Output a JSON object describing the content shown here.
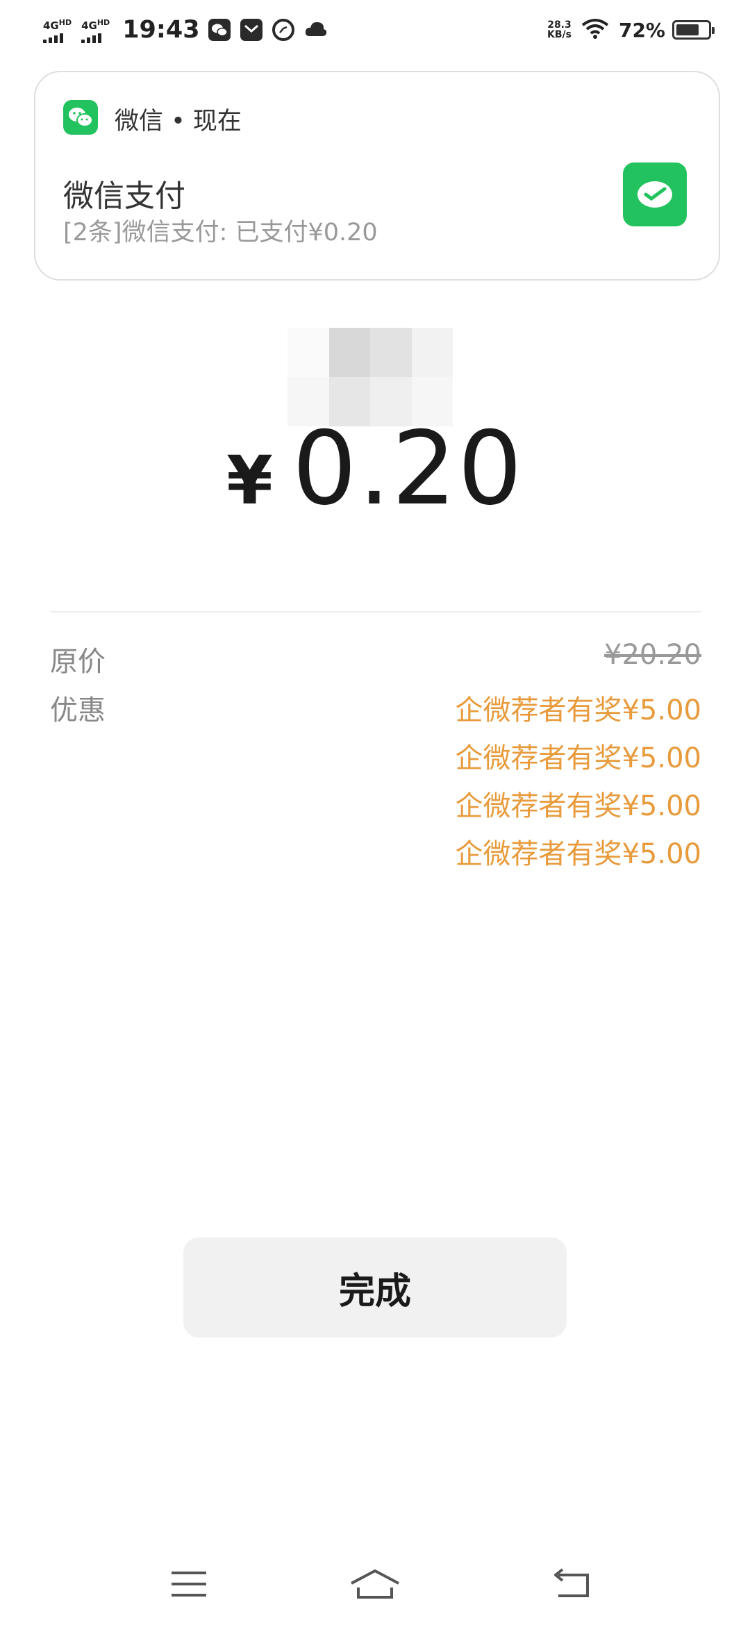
{
  "status_bar": {
    "signal1": "4G",
    "signal1_sup": "HD",
    "signal2": "4G",
    "signal2_sup": "HD",
    "time": "19:43",
    "net_speed_value": "28.3",
    "net_speed_unit": "KB/s",
    "battery_percent": "72%"
  },
  "notification": {
    "app_name": "微信 • 现在",
    "title": "微信支付",
    "body": "[2条]微信支付: 已支付¥0.20",
    "app_icon": "wechat-icon",
    "pay_icon": "wechat-pay-icon"
  },
  "payment": {
    "currency_symbol": "¥",
    "amount": "0.20"
  },
  "details": {
    "original_label": "原价",
    "original_value": "¥20.20",
    "discount_label": "优惠",
    "discounts": [
      "企微荐者有奖¥5.00",
      "企微荐者有奖¥5.00",
      "企微荐者有奖¥5.00",
      "企微荐者有奖¥5.00"
    ]
  },
  "done_button": {
    "label": "完成"
  },
  "colors": {
    "wechat_green": "#22c35e",
    "discount_orange": "#e89b3c",
    "button_bg": "#f1f1f1"
  },
  "nav": {
    "menu_icon": "menu-icon",
    "home_icon": "home-icon",
    "back_icon": "back-icon"
  }
}
